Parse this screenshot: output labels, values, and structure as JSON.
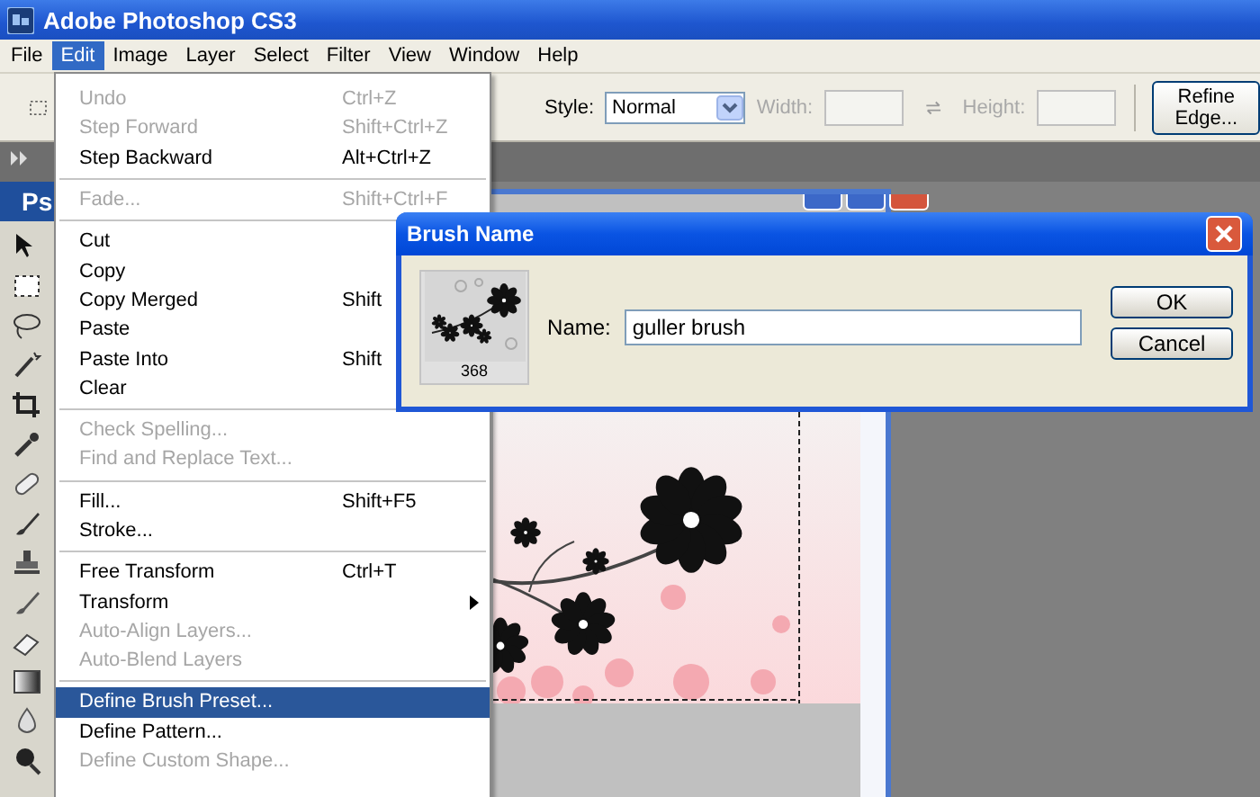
{
  "window": {
    "title": "Adobe Photoshop CS3"
  },
  "menu_bar": [
    {
      "label": "File",
      "selected": false
    },
    {
      "label": "Edit",
      "selected": true
    },
    {
      "label": "Image",
      "selected": false
    },
    {
      "label": "Layer",
      "selected": false
    },
    {
      "label": "Select",
      "selected": false
    },
    {
      "label": "Filter",
      "selected": false
    },
    {
      "label": "View",
      "selected": false
    },
    {
      "label": "Window",
      "selected": false
    },
    {
      "label": "Help",
      "selected": false
    }
  ],
  "options_bar": {
    "style_label": "Style:",
    "style_value": "Normal",
    "width": {
      "label": "Width:",
      "disabled": true
    },
    "height": {
      "label": "Height:",
      "disabled": true
    },
    "refine_button": "Refine Edge..."
  },
  "toolbox": {
    "title": "Ps"
  },
  "edit_menu": [
    {
      "kind": "item",
      "label": "Undo",
      "shortcut": "Ctrl+Z",
      "disabled": true,
      "selected": false
    },
    {
      "kind": "item",
      "label": "Step Forward",
      "shortcut": "Shift+Ctrl+Z",
      "disabled": true,
      "selected": false
    },
    {
      "kind": "item",
      "label": "Step Backward",
      "shortcut": "Alt+Ctrl+Z",
      "disabled": false,
      "selected": false
    },
    {
      "kind": "separator"
    },
    {
      "kind": "item",
      "label": "Fade...",
      "shortcut": "Shift+Ctrl+F",
      "disabled": true,
      "selected": false
    },
    {
      "kind": "separator"
    },
    {
      "kind": "item",
      "label": "Cut",
      "disabled": false,
      "selected": false
    },
    {
      "kind": "item",
      "label": "Copy",
      "disabled": false,
      "selected": false
    },
    {
      "kind": "item",
      "label": "Copy Merged",
      "shortcut": "Shift",
      "disabled": false,
      "selected": false
    },
    {
      "kind": "item",
      "label": "Paste",
      "disabled": false,
      "selected": false
    },
    {
      "kind": "item",
      "label": "Paste Into",
      "shortcut": "Shift",
      "disabled": false,
      "selected": false
    },
    {
      "kind": "item",
      "label": "Clear",
      "disabled": false,
      "selected": false
    },
    {
      "kind": "separator"
    },
    {
      "kind": "item",
      "label": "Check Spelling...",
      "disabled": true,
      "selected": false
    },
    {
      "kind": "item",
      "label": "Find and Replace Text...",
      "disabled": true,
      "selected": false
    },
    {
      "kind": "separator"
    },
    {
      "kind": "item",
      "label": "Fill...",
      "shortcut": "Shift+F5",
      "disabled": false,
      "selected": false
    },
    {
      "kind": "item",
      "label": "Stroke...",
      "disabled": false,
      "selected": false
    },
    {
      "kind": "separator"
    },
    {
      "kind": "item",
      "label": "Free Transform",
      "shortcut": "Ctrl+T",
      "disabled": false,
      "selected": false
    },
    {
      "kind": "submenu",
      "label": "Transform",
      "disabled": false,
      "selected": false
    },
    {
      "kind": "item",
      "label": "Auto-Align Layers...",
      "disabled": true,
      "selected": false
    },
    {
      "kind": "item",
      "label": "Auto-Blend Layers",
      "disabled": true,
      "selected": false
    },
    {
      "kind": "separator"
    },
    {
      "kind": "item",
      "label": "Define Brush Preset...",
      "disabled": false,
      "selected": true
    },
    {
      "kind": "item",
      "label": "Define Pattern...",
      "disabled": false,
      "selected": false
    },
    {
      "kind": "item",
      "label": "Define Custom Shape...",
      "disabled": true,
      "selected": false
    }
  ],
  "dialog": {
    "title": "Brush Name",
    "preview_caption": "368",
    "name_label": "Name:",
    "name_value": "guller brush",
    "buttons": [
      "OK",
      "Cancel"
    ]
  }
}
